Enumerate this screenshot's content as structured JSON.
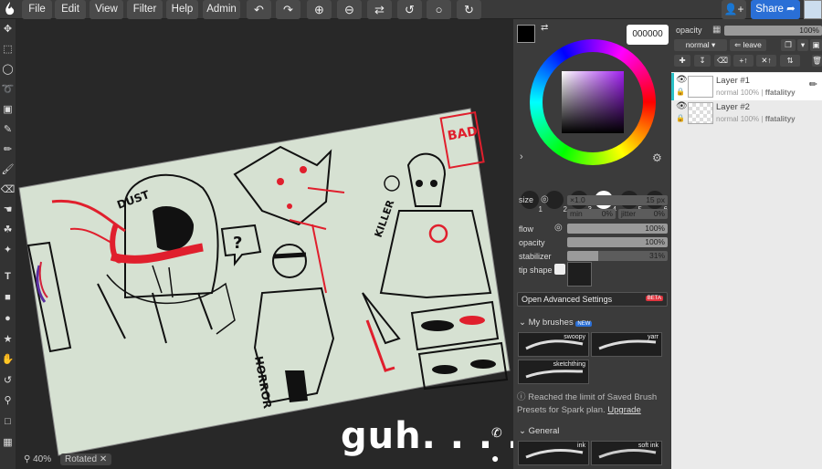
{
  "menu": {
    "items": [
      "File",
      "Edit",
      "View",
      "Filter",
      "Help",
      "Admin"
    ],
    "share_label": "Share"
  },
  "canvas": {
    "zoom": "40%",
    "rotated_label": "Rotated",
    "caption": "guh. . . .",
    "sketch_texts": [
      "DUST",
      "BAD",
      "HORROR",
      "KILLER",
      "?"
    ]
  },
  "color": {
    "hex": "000000",
    "primary": "#000000",
    "secondary": "#000000"
  },
  "brush": {
    "sizes": [
      "1",
      "2",
      "3",
      "4",
      "5",
      "6"
    ],
    "selected_size_index": 3,
    "size_label": "size",
    "size_value": "15 px",
    "size_multiplier": "×1.0",
    "min_label": "min",
    "min_value": "0%",
    "jitter_label": "jitter",
    "jitter_value": "0%",
    "flow_label": "flow",
    "flow_value": "100%",
    "flow_fraction": 1.0,
    "opacity_label": "opacity",
    "opacity_value": "100%",
    "opacity_fraction": 1.0,
    "stabilizer_label": "stabilizer",
    "stabilizer_value": "31%",
    "stabilizer_fraction": 0.31,
    "tip_shape_label": "tip shape",
    "advanced_label": "Open Advanced Settings",
    "advanced_badge": "BETA",
    "my_brushes_label": "My brushes",
    "my_brushes_badge": "NEW",
    "presets": [
      "swoopy",
      "yarr",
      "sketchthing"
    ],
    "limit_text": "Reached the limit of Saved Brush Presets for Spark plan.",
    "upgrade_label": "Upgrade",
    "general_label": "General",
    "general_presets": [
      "ink",
      "soft ink"
    ]
  },
  "layers": {
    "opacity_label": "opacity",
    "opacity_value": "100%",
    "blend_mode": "normal",
    "leave_label": "leave",
    "items": [
      {
        "name": "Layer #1",
        "mode": "normal",
        "opacity": "100%",
        "owner": "ffatalityy"
      },
      {
        "name": "Layer #2",
        "mode": "normal",
        "opacity": "100%",
        "owner": "ffatalityy"
      }
    ]
  }
}
